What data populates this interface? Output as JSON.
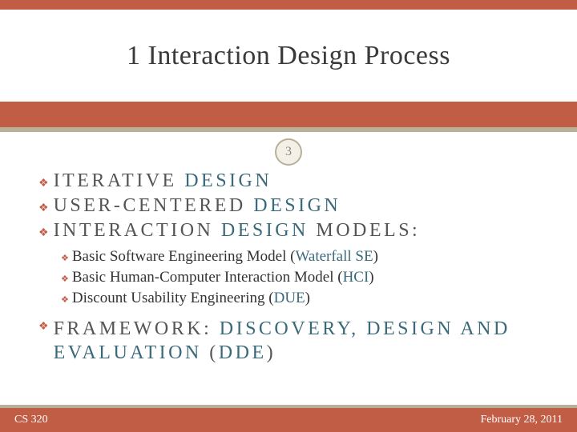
{
  "title": "1 Interaction Design Process",
  "page_number": "3",
  "bullets": {
    "b1_pre": "ITERATIVE ",
    "b1_accent": "DESIGN",
    "b2_pre": "USER-CENTERED ",
    "b2_accent": "DESIGN",
    "b3_pre": "INTERACTION ",
    "b3_accent": "DESIGN",
    "b3_post": " MODELS:"
  },
  "subs": {
    "s1_pre": "Basic Software Engineering Model (",
    "s1_accent": "Waterfall SE",
    "s1_post": ")",
    "s2_pre": "Basic Human-Computer Interaction Model  (",
    "s2_accent": "HCI",
    "s2_post": ")",
    "s3_pre": "Discount Usability Engineering (",
    "s3_accent": "DUE",
    "s3_post": ")"
  },
  "b4_pre": "FRAMEWORK: ",
  "b4_accent": "DISCOVERY, DESIGN AND EVALUATION",
  "b4_post": " (",
  "b4_accent2": "DDE",
  "b4_post2": ")",
  "footer": {
    "left": "CS 320",
    "right": "February 28, 2011"
  }
}
